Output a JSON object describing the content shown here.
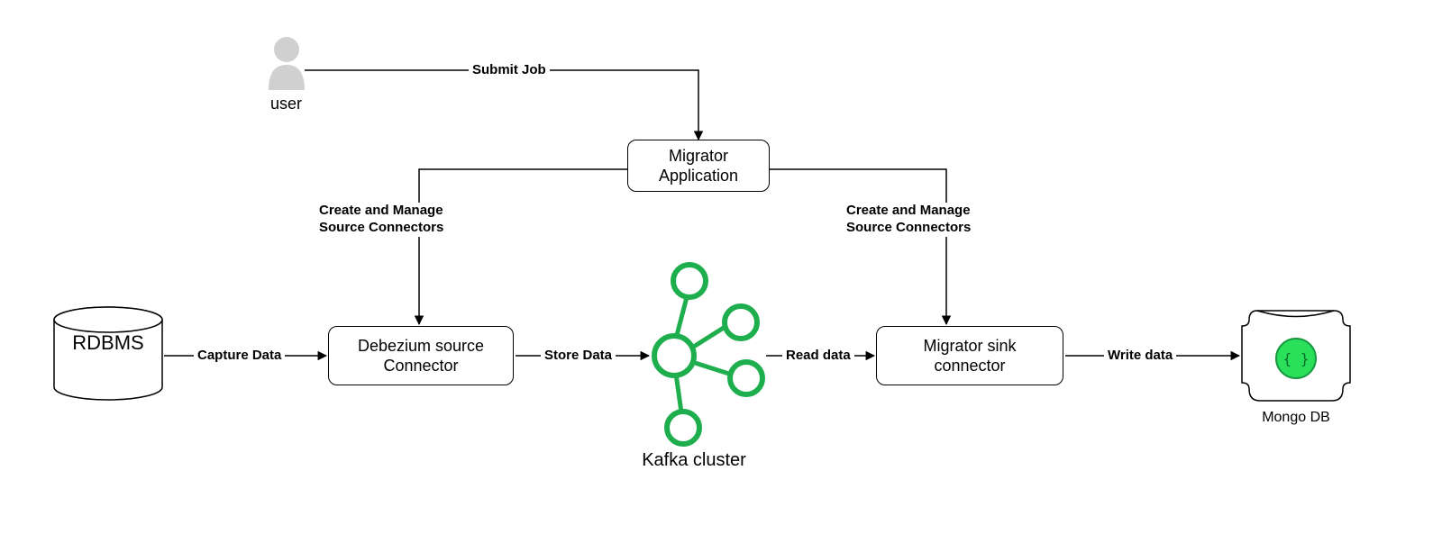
{
  "nodes": {
    "user": {
      "label": "user"
    },
    "migrator_app": {
      "label": "Migrator\nApplication"
    },
    "rdbms": {
      "label": "RDBMS"
    },
    "debezium": {
      "label": "Debezium source\nConnector"
    },
    "kafka": {
      "label": "Kafka cluster"
    },
    "sink": {
      "label": "Migrator sink\nconnector"
    },
    "mongo": {
      "label": "Mongo DB"
    }
  },
  "edges": {
    "submit_job": {
      "label": "Submit Job"
    },
    "manage_source_left": {
      "label": "Create and Manage\nSource Connectors"
    },
    "manage_source_right": {
      "label": "Create and Manage\nSource Connectors"
    },
    "capture_data": {
      "label": "Capture Data"
    },
    "store_data": {
      "label": "Store Data"
    },
    "read_data": {
      "label": "Read data"
    },
    "write_data": {
      "label": "Write data"
    }
  }
}
